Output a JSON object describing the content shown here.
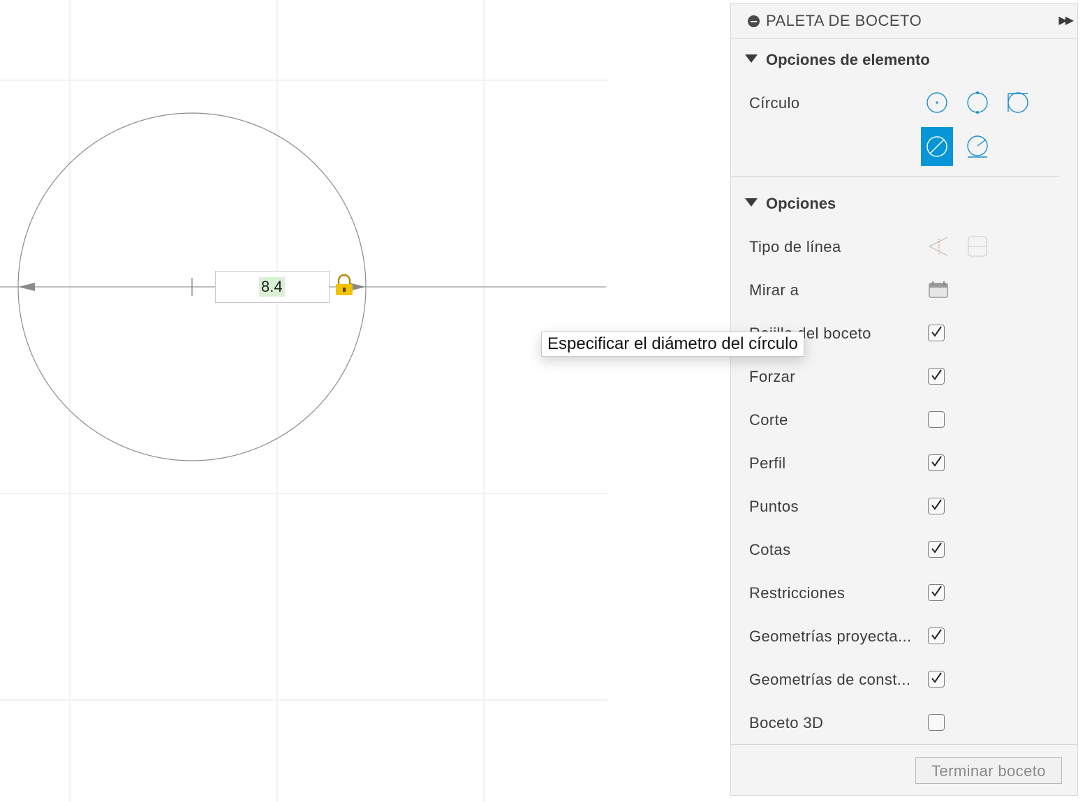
{
  "canvas": {
    "dimension_value": "8.4"
  },
  "tooltip": {
    "text": "Especificar el diámetro del círculo"
  },
  "palette": {
    "title": "PALETA DE BOCETO",
    "expand_icon": "double-chevron-right-icon",
    "element_options": {
      "heading": "Opciones de elemento",
      "circle_label": "Círculo",
      "tools": [
        {
          "name": "center-diameter-circle",
          "active": false
        },
        {
          "name": "2-point-circle",
          "active": false
        },
        {
          "name": "3-point-circle",
          "active": false
        },
        {
          "name": "diameter-dimension-circle",
          "active": true
        },
        {
          "name": "tangent-circle",
          "active": false
        }
      ]
    },
    "options": {
      "heading": "Opciones",
      "linetype_label": "Tipo de línea",
      "look_at_label": "Mirar a",
      "checkboxes": [
        {
          "label": "Rejilla del boceto",
          "checked": true
        },
        {
          "label": "Forzar",
          "checked": true
        },
        {
          "label": "Corte",
          "checked": false
        },
        {
          "label": "Perfil",
          "checked": true
        },
        {
          "label": "Puntos",
          "checked": true
        },
        {
          "label": "Cotas",
          "checked": true
        },
        {
          "label": "Restricciones",
          "checked": true
        },
        {
          "label": "Geometrías proyecta...",
          "checked": true
        },
        {
          "label": "Geometrías de const...",
          "checked": true
        },
        {
          "label": "Boceto 3D",
          "checked": false
        }
      ]
    },
    "finish_button": "Terminar boceto"
  },
  "colors": {
    "accent": "#0696d7",
    "grid": "#ececec",
    "lock": "#f2c200"
  }
}
